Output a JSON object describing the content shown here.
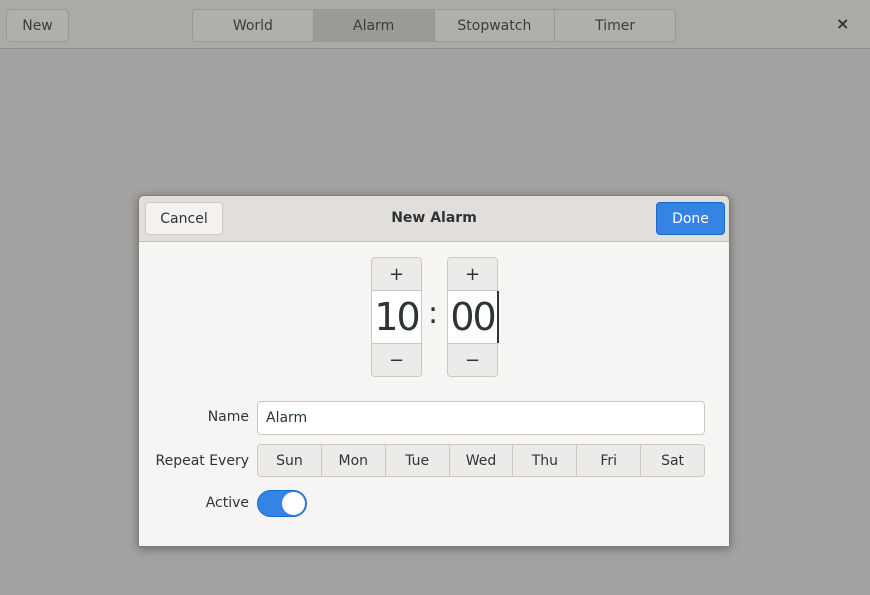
{
  "header": {
    "new_label": "New",
    "tabs": [
      {
        "label": "World"
      },
      {
        "label": "Alarm",
        "active": true
      },
      {
        "label": "Stopwatch"
      },
      {
        "label": "Timer"
      }
    ],
    "close": "×"
  },
  "dialog": {
    "title": "New Alarm",
    "cancel_label": "Cancel",
    "done_label": "Done",
    "time": {
      "hours": "10",
      "minutes": "00",
      "separator": ":",
      "plus": "+",
      "minus": "−"
    },
    "name_label": "Name",
    "name_value": "Alarm",
    "repeat_label": "Repeat Every",
    "days": [
      "Sun",
      "Mon",
      "Tue",
      "Wed",
      "Thu",
      "Fri",
      "Sat"
    ],
    "active_label": "Active",
    "active": true
  },
  "colors": {
    "accent": "#3584e4"
  }
}
